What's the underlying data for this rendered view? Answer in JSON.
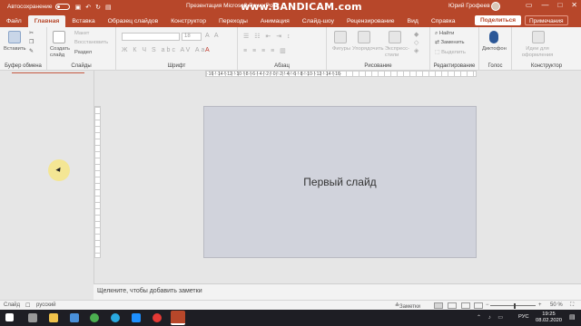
{
  "titlebar": {
    "autosave_label": "Автосохранение",
    "doc_title": "Презентация Microsoft PowerPoint",
    "watermark": "www.BANDICAM.com",
    "user_name": "Юрий Грофеев",
    "qat_icons": [
      "save-icon",
      "undo-icon",
      "redo-icon",
      "start-from-beginning-icon"
    ],
    "window_controls": [
      "—",
      "□",
      "✕"
    ]
  },
  "tabs": {
    "items": [
      "Файл",
      "Главная",
      "Вставка",
      "Образец слайдов",
      "Конструктор",
      "Переходы",
      "Анимация",
      "Слайд-шоу",
      "Рецензирование",
      "Вид",
      "Справка"
    ],
    "active": "Главная",
    "share_label": "Поделиться",
    "notes_label": "Примечания"
  },
  "ribbon": {
    "clipboard": {
      "paste": "Вставить",
      "label": "Буфер обмена"
    },
    "slides": {
      "new_slide": "Создать слайд",
      "layout": "Макет",
      "reset": "Восстановить",
      "section": "Раздел",
      "label": "Слайды"
    },
    "font": {
      "font_name": "",
      "font_size": "18",
      "label": "Шрифт"
    },
    "paragraph": {
      "label": "Абзац"
    },
    "drawing": {
      "shapes": "Фигуры",
      "arrange": "Упорядочить",
      "quick_styles": "Экспресс-стили",
      "label": "Рисование"
    },
    "editing": {
      "find": "Найти",
      "replace": "Заменить",
      "select": "Выделить",
      "label": "Редактирование"
    },
    "voice": {
      "dictate": "Диктофон",
      "label": "Голос"
    },
    "designer": {
      "design_ideas": "Идеи для оформления",
      "label": "Конструктор"
    }
  },
  "ruler": {
    "horizontal_label": "·16·!·14·!·12·!·10·!·8·!·6·!·4·!·2·!·0·!·2·!·4·!·6·!·8·!·10·!·12·!·14·!·16·"
  },
  "slide": {
    "title": "Первый слайд"
  },
  "notes": {
    "placeholder": "Щелкните, чтобы добавить заметки"
  },
  "statusbar": {
    "slide_label": "Слайд",
    "language": "русский",
    "notes_button": "Заметки",
    "zoom": "50 %"
  },
  "taskbar": {
    "lang": "РУС",
    "time": "19:25",
    "date": "08.02.2020",
    "tray": "⌃ ♪ ▭"
  },
  "colors": {
    "accent": "#b7472a",
    "ribbon_bg": "#f3f3f3",
    "slide_bg": "#d1d3dc",
    "taskbar_bg": "#1e1e24"
  }
}
